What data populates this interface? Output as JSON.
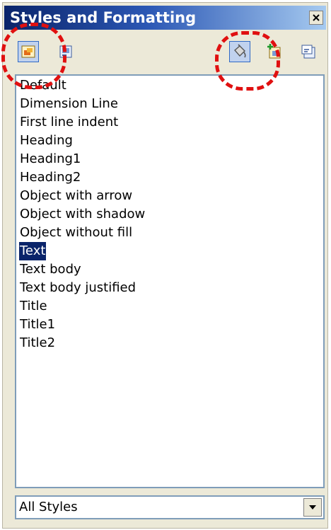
{
  "window": {
    "title": "Styles and Formatting",
    "close_label": "×"
  },
  "toolbar": {
    "buttons": [
      {
        "name": "graphics-styles-button",
        "icon": "graphics-styles-icon",
        "pressed": true
      },
      {
        "name": "presentation-styles-button",
        "icon": "presentation-styles-icon",
        "pressed": false
      },
      {
        "name": "fill-format-mode-button",
        "icon": "paint-bucket-icon",
        "pressed": true
      },
      {
        "name": "new-style-from-selection-button",
        "icon": "new-style-icon",
        "pressed": false
      },
      {
        "name": "update-style-button",
        "icon": "update-style-icon",
        "pressed": false
      }
    ]
  },
  "styles_list": {
    "items": [
      "Default",
      "Dimension Line",
      "First line indent",
      "Heading",
      "Heading1",
      "Heading2",
      "Object with arrow",
      "Object with shadow",
      "Object without fill",
      "Text",
      "Text body",
      "Text body justified",
      "Title",
      "Title1",
      "Title2"
    ],
    "selected": "Text"
  },
  "filter": {
    "selected": "All Styles"
  },
  "colors": {
    "selection": "#0a246a",
    "annotation": "#e01010",
    "title_gradient_start": "#0a246a",
    "title_gradient_end": "#a6caf0"
  }
}
